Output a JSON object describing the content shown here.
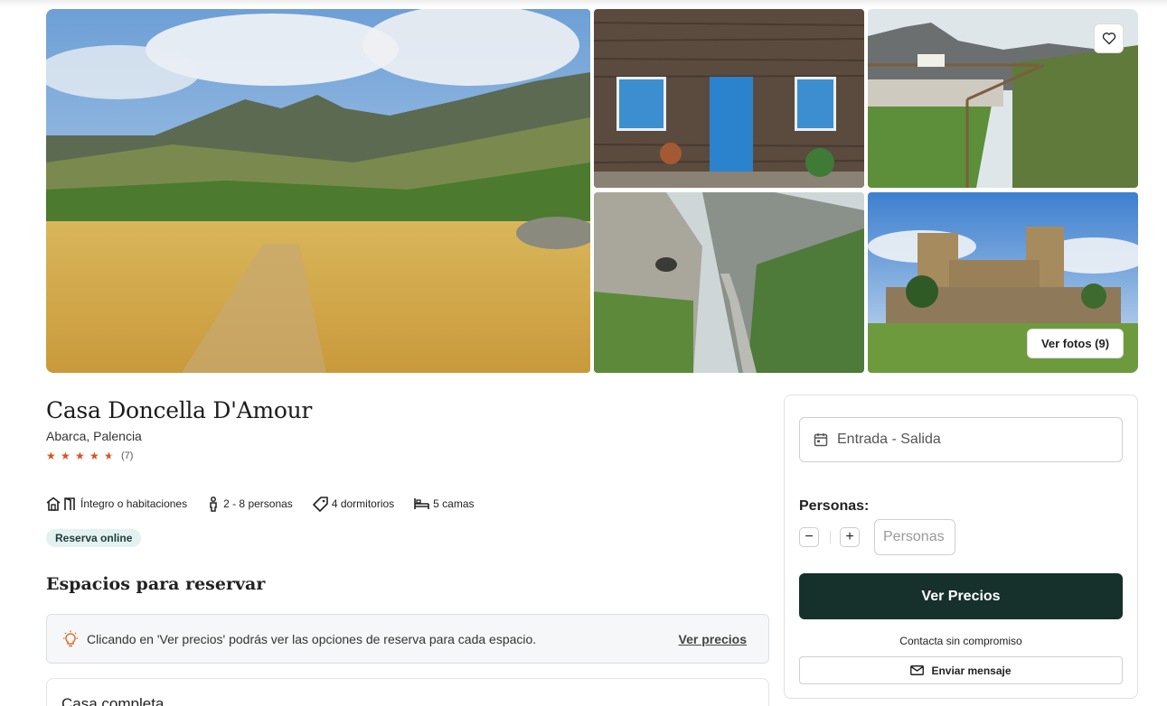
{
  "gallery": {
    "photos": [
      {
        "icon": "mountain-meadow-photo"
      },
      {
        "icon": "stone-house-blue-door-photo"
      },
      {
        "icon": "viewpoint-balcony-photo"
      },
      {
        "icon": "gorge-road-photo"
      },
      {
        "icon": "castle-photo"
      }
    ],
    "favorite_icon": "heart-icon",
    "view_photos_label": "Ver fotos (9)"
  },
  "listing": {
    "title": "Casa Doncella D'Amour",
    "location": "Abarca, Palencia",
    "rating": 4.5,
    "reviews": "(7)",
    "features": [
      {
        "icon": "house-door-icon",
        "label": "Íntegro o habitaciones"
      },
      {
        "icon": "person-icon",
        "label": "2 - 8 personas"
      },
      {
        "icon": "key-tag-icon",
        "label": "4 dormitorios"
      },
      {
        "icon": "bed-icon",
        "label": "5 camas"
      }
    ],
    "badge": "Reserva online"
  },
  "spaces": {
    "title": "Espacios para reservar",
    "info_icon": "lightbulb-icon",
    "info_text": "Clicando en 'Ver precios' podrás ver las opciones de reserva para cada espacio.",
    "info_link": "Ver precios",
    "first_space": "Casa completa"
  },
  "booking": {
    "dates_icon": "calendar-icon",
    "dates_placeholder": "Entrada - Salida",
    "persons_label": "Personas:",
    "minus": "−",
    "plus": "+",
    "persons_placeholder": "Personas",
    "cta": "Ver Precios",
    "contact_note": "Contacta sin compromiso",
    "message_icon": "envelope-icon",
    "message_button": "Enviar mensaje"
  },
  "colors": {
    "accent_dark": "#16302c",
    "star": "#d9531e",
    "badge_bg": "#e3f1f1"
  }
}
